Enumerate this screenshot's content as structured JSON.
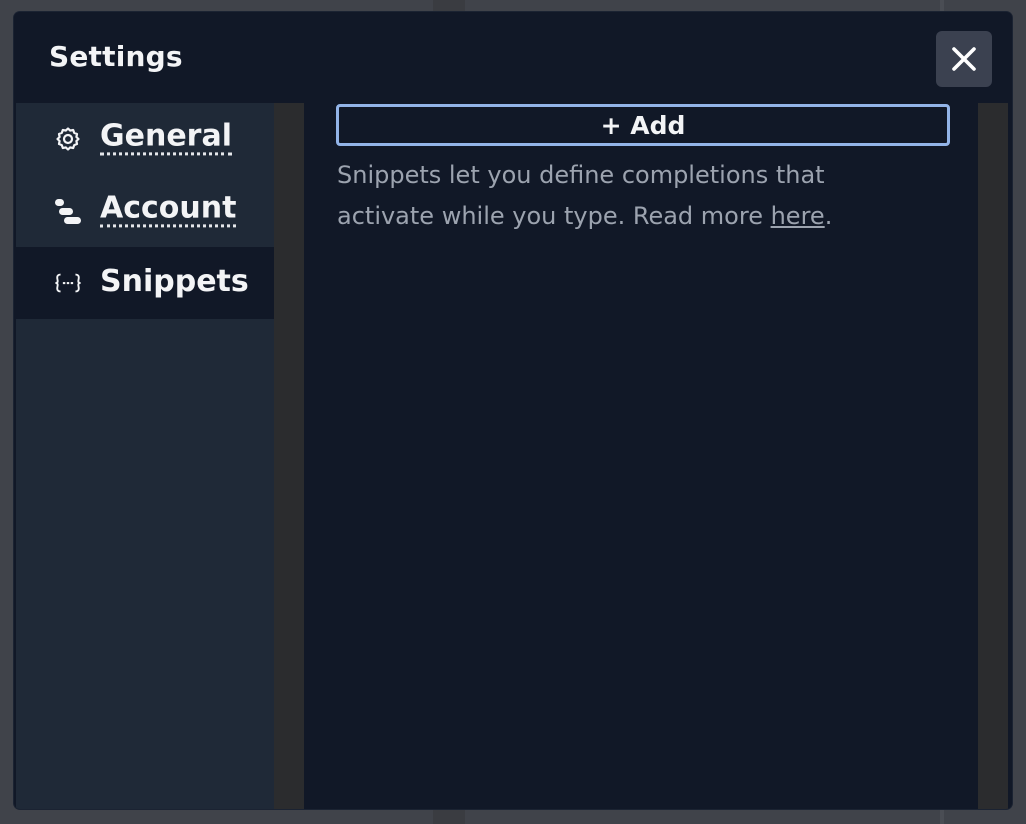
{
  "modal": {
    "title": "Settings",
    "close_icon": "close-icon"
  },
  "sidebar": {
    "items": [
      {
        "label": "General",
        "icon": "gear-icon",
        "active": false
      },
      {
        "label": "Account",
        "icon": "account-icon",
        "active": false
      },
      {
        "label": "Snippets",
        "icon": "snippets-icon",
        "active": true
      }
    ]
  },
  "snippets": {
    "add_button_label": "+ Add",
    "help_text_before": "Snippets let you define completions that activate while you type. Read more ",
    "help_link_label": "here",
    "help_text_after": "."
  },
  "colors": {
    "modal_bg": "#111827",
    "sidebar_bg": "#1f2937",
    "accent_border": "#93b4e8",
    "text_primary": "#f3f4f6",
    "text_muted": "#9ca3af"
  }
}
